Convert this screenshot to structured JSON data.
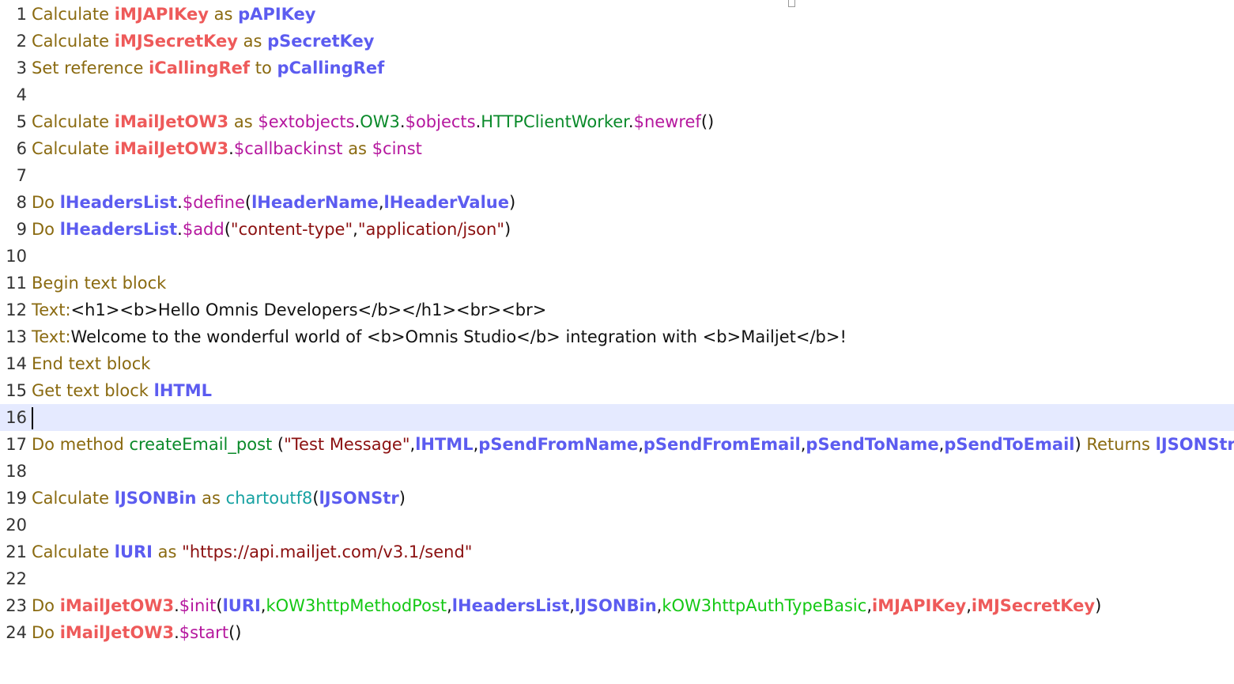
{
  "editor": {
    "current_line": 16,
    "lines": [
      {
        "n": "1",
        "tokens": [
          {
            "t": "Calculate ",
            "c": "cmd"
          },
          {
            "t": "iMJAPIKey",
            "c": "ivar"
          },
          {
            "t": " as ",
            "c": "cmd"
          },
          {
            "t": "pAPIKey",
            "c": "lvar"
          }
        ]
      },
      {
        "n": "2",
        "tokens": [
          {
            "t": "Calculate ",
            "c": "cmd"
          },
          {
            "t": "iMJSecretKey",
            "c": "ivar"
          },
          {
            "t": " as ",
            "c": "cmd"
          },
          {
            "t": "pSecretKey",
            "c": "lvar"
          }
        ]
      },
      {
        "n": "3",
        "tokens": [
          {
            "t": "Set reference ",
            "c": "cmd"
          },
          {
            "t": "iCallingRef",
            "c": "ivar"
          },
          {
            "t": " to ",
            "c": "cmd"
          },
          {
            "t": "pCallingRef",
            "c": "lvar"
          }
        ]
      },
      {
        "n": "4",
        "tokens": []
      },
      {
        "n": "5",
        "tokens": [
          {
            "t": "Calculate ",
            "c": "cmd"
          },
          {
            "t": "iMailJetOW3",
            "c": "ivar"
          },
          {
            "t": " as ",
            "c": "cmd"
          },
          {
            "t": "$extobjects",
            "c": "prop"
          },
          {
            "t": ".",
            "c": "punct"
          },
          {
            "t": "OW3",
            "c": "fn"
          },
          {
            "t": ".",
            "c": "punct"
          },
          {
            "t": "$objects",
            "c": "prop"
          },
          {
            "t": ".",
            "c": "punct"
          },
          {
            "t": "HTTPClientWorker",
            "c": "fn"
          },
          {
            "t": ".",
            "c": "punct"
          },
          {
            "t": "$newref",
            "c": "prop"
          },
          {
            "t": "()",
            "c": "punct"
          }
        ]
      },
      {
        "n": "6",
        "tokens": [
          {
            "t": "Calculate ",
            "c": "cmd"
          },
          {
            "t": "iMailJetOW3",
            "c": "ivar"
          },
          {
            "t": ".",
            "c": "punct"
          },
          {
            "t": "$callbackinst",
            "c": "prop"
          },
          {
            "t": " as ",
            "c": "cmd"
          },
          {
            "t": "$cinst",
            "c": "prop"
          }
        ]
      },
      {
        "n": "7",
        "tokens": []
      },
      {
        "n": "8",
        "tokens": [
          {
            "t": "Do ",
            "c": "cmd"
          },
          {
            "t": "lHeadersList",
            "c": "lvar"
          },
          {
            "t": ".",
            "c": "punct"
          },
          {
            "t": "$define",
            "c": "prop"
          },
          {
            "t": "(",
            "c": "punct"
          },
          {
            "t": "lHeaderName",
            "c": "lvar"
          },
          {
            "t": ",",
            "c": "punct"
          },
          {
            "t": "lHeaderValue",
            "c": "lvar"
          },
          {
            "t": ")",
            "c": "punct"
          }
        ]
      },
      {
        "n": "9",
        "tokens": [
          {
            "t": "Do ",
            "c": "cmd"
          },
          {
            "t": "lHeadersList",
            "c": "lvar"
          },
          {
            "t": ".",
            "c": "punct"
          },
          {
            "t": "$add",
            "c": "prop"
          },
          {
            "t": "(",
            "c": "punct"
          },
          {
            "t": "\"content-type\"",
            "c": "str"
          },
          {
            "t": ",",
            "c": "punct"
          },
          {
            "t": "\"application/json\"",
            "c": "str"
          },
          {
            "t": ")",
            "c": "punct"
          }
        ]
      },
      {
        "n": "10",
        "tokens": []
      },
      {
        "n": "11",
        "tokens": [
          {
            "t": "Begin text block",
            "c": "cmd"
          }
        ]
      },
      {
        "n": "12",
        "tokens": [
          {
            "t": "Text:",
            "c": "cmd"
          },
          {
            "t": "<h1><b>Hello Omnis Developers</b></h1><br><br>",
            "c": "plain"
          }
        ]
      },
      {
        "n": "13",
        "tokens": [
          {
            "t": "Text:",
            "c": "cmd"
          },
          {
            "t": "Welcome to the wonderful world of <b>Omnis Studio</b> integration with <b>Mailjet</b>!",
            "c": "plain"
          }
        ]
      },
      {
        "n": "14",
        "tokens": [
          {
            "t": "End text block",
            "c": "cmd"
          }
        ]
      },
      {
        "n": "15",
        "tokens": [
          {
            "t": "Get text block ",
            "c": "cmd"
          },
          {
            "t": "lHTML",
            "c": "lvar"
          }
        ]
      },
      {
        "n": "16",
        "tokens": []
      },
      {
        "n": "17",
        "tokens": [
          {
            "t": "Do method ",
            "c": "cmd"
          },
          {
            "t": "createEmail_post",
            "c": "fn"
          },
          {
            "t": " (",
            "c": "punct"
          },
          {
            "t": "\"Test Message\"",
            "c": "str"
          },
          {
            "t": ",",
            "c": "punct"
          },
          {
            "t": "lHTML",
            "c": "lvar"
          },
          {
            "t": ",",
            "c": "punct"
          },
          {
            "t": "pSendFromName",
            "c": "lvar"
          },
          {
            "t": ",",
            "c": "punct"
          },
          {
            "t": "pSendFromEmail",
            "c": "lvar"
          },
          {
            "t": ",",
            "c": "punct"
          },
          {
            "t": "pSendToName",
            "c": "lvar"
          },
          {
            "t": ",",
            "c": "punct"
          },
          {
            "t": "pSendToEmail",
            "c": "lvar"
          },
          {
            "t": ")",
            "c": "punct"
          },
          {
            "t": " Returns ",
            "c": "cmd"
          },
          {
            "t": "lJSONStr",
            "c": "lvar"
          }
        ]
      },
      {
        "n": "18",
        "tokens": []
      },
      {
        "n": "19",
        "tokens": [
          {
            "t": "Calculate ",
            "c": "cmd"
          },
          {
            "t": "lJSONBin",
            "c": "lvar"
          },
          {
            "t": " as ",
            "c": "cmd"
          },
          {
            "t": "chartoutf8",
            "c": "func"
          },
          {
            "t": "(",
            "c": "punct"
          },
          {
            "t": "lJSONStr",
            "c": "lvar"
          },
          {
            "t": ")",
            "c": "punct"
          }
        ]
      },
      {
        "n": "20",
        "tokens": []
      },
      {
        "n": "21",
        "tokens": [
          {
            "t": "Calculate ",
            "c": "cmd"
          },
          {
            "t": "lURI",
            "c": "lvar"
          },
          {
            "t": " as ",
            "c": "cmd"
          },
          {
            "t": "\"https://api.mailjet.com/v3.1/send\"",
            "c": "str"
          }
        ]
      },
      {
        "n": "22",
        "tokens": []
      },
      {
        "n": "23",
        "tokens": [
          {
            "t": "Do ",
            "c": "cmd"
          },
          {
            "t": "iMailJetOW3",
            "c": "ivar"
          },
          {
            "t": ".",
            "c": "punct"
          },
          {
            "t": "$init",
            "c": "prop"
          },
          {
            "t": "(",
            "c": "punct"
          },
          {
            "t": "lURI",
            "c": "lvar"
          },
          {
            "t": ",",
            "c": "punct"
          },
          {
            "t": "kOW3httpMethodPost",
            "c": "konst"
          },
          {
            "t": ",",
            "c": "punct"
          },
          {
            "t": "lHeadersList",
            "c": "lvar"
          },
          {
            "t": ",",
            "c": "punct"
          },
          {
            "t": "lJSONBin",
            "c": "lvar"
          },
          {
            "t": ",",
            "c": "punct"
          },
          {
            "t": "kOW3httpAuthTypeBasic",
            "c": "konst"
          },
          {
            "t": ",",
            "c": "punct"
          },
          {
            "t": "iMJAPIKey",
            "c": "ivar"
          },
          {
            "t": ",",
            "c": "punct"
          },
          {
            "t": "iMJSecretKey",
            "c": "ivar"
          },
          {
            "t": ")",
            "c": "punct"
          }
        ]
      },
      {
        "n": "24",
        "tokens": [
          {
            "t": "Do ",
            "c": "cmd"
          },
          {
            "t": "iMailJetOW3",
            "c": "ivar"
          },
          {
            "t": ".",
            "c": "punct"
          },
          {
            "t": "$start",
            "c": "prop"
          },
          {
            "t": "()",
            "c": "punct"
          }
        ]
      }
    ]
  },
  "colors": {
    "command": "#8a6a10",
    "instance_variable": "#ee5a5a",
    "local_variable": "#5c5cf0",
    "property": "#b5179e",
    "function": "#0a8a2a",
    "string": "#8b1010",
    "constant": "#14c814",
    "current_line_highlight": "#e5eaff"
  }
}
